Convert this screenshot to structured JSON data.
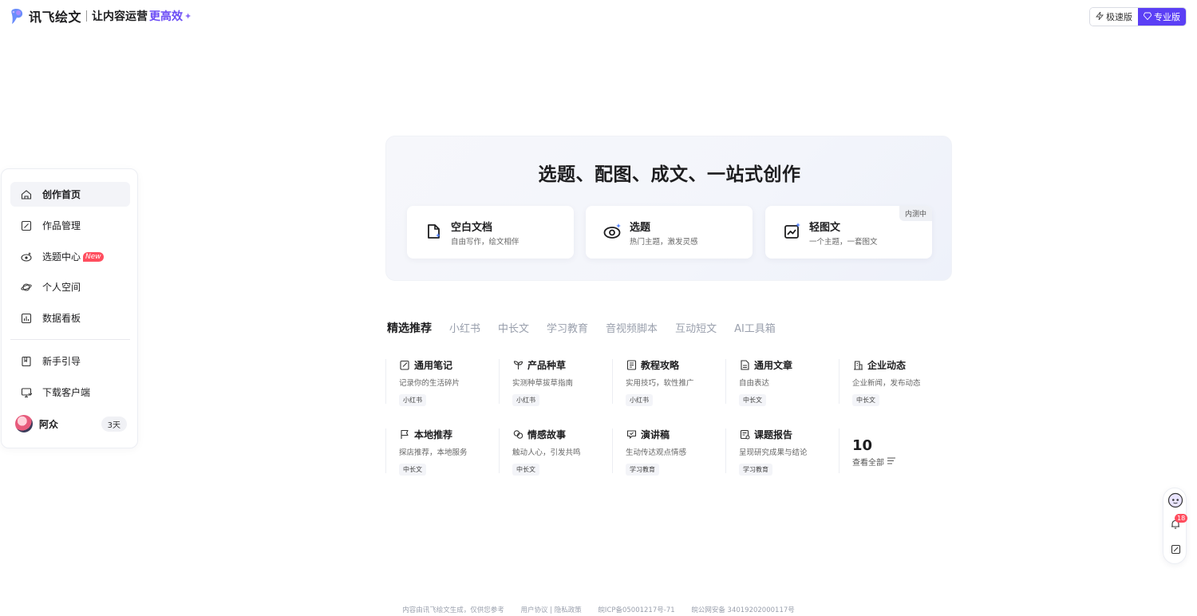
{
  "header": {
    "brand": "讯飞绘文",
    "slogan": "让内容运营",
    "slogan_accent": "更高效",
    "versions": [
      {
        "label": "极速版",
        "icon": "lightning-icon",
        "active": false
      },
      {
        "label": "专业版",
        "icon": "diamond-icon",
        "active": true
      }
    ]
  },
  "sidebar": {
    "items": [
      {
        "label": "创作首页",
        "icon": "home-icon",
        "active": true
      },
      {
        "label": "作品管理",
        "icon": "edit-doc-icon"
      },
      {
        "label": "选题中心",
        "icon": "eye-sparkle-icon",
        "badge": "New"
      },
      {
        "label": "个人空间",
        "icon": "planet-icon"
      },
      {
        "label": "数据看板",
        "icon": "chart-board-icon"
      },
      {
        "label": "新手引导",
        "icon": "book-icon"
      },
      {
        "label": "下载客户端",
        "icon": "monitor-download-icon"
      }
    ],
    "user": {
      "name": "阿众",
      "days": "3天"
    }
  },
  "hero": {
    "title": "选题、配图、成文、一站式创作",
    "cards": [
      {
        "title": "空白文档",
        "desc": "自由写作，绘文相伴",
        "icon": "doc-sparkle-icon"
      },
      {
        "title": "选题",
        "desc": "热门主题，激发灵感",
        "icon": "eye-sparkle-icon"
      },
      {
        "title": "轻图文",
        "desc": "一个主题，一套图文",
        "icon": "chart-sparkle-icon",
        "tag": "内测中"
      }
    ]
  },
  "tabs": [
    "精选推荐",
    "小红书",
    "中长文",
    "学习教育",
    "音视频脚本",
    "互动短文",
    "AI工具箱"
  ],
  "templates": [
    {
      "title": "通用笔记",
      "desc": "记录你的生活碎片",
      "tag": "小红书",
      "icon": "note-edit-icon"
    },
    {
      "title": "产品种草",
      "desc": "实测种草拔草指南",
      "tag": "小红书",
      "icon": "sprout-icon"
    },
    {
      "title": "教程攻略",
      "desc": "实用技巧，软性推广",
      "tag": "小红书",
      "icon": "book-list-icon"
    },
    {
      "title": "通用文章",
      "desc": "自由表达",
      "tag": "中长文",
      "icon": "article-icon"
    },
    {
      "title": "企业动态",
      "desc": "企业新闻，发布动态",
      "tag": "中长文",
      "icon": "building-icon"
    },
    {
      "title": "本地推荐",
      "desc": "探店推荐，本地服务",
      "tag": "中长文",
      "icon": "flag-icon"
    },
    {
      "title": "情感故事",
      "desc": "触动人心，引发共鸣",
      "tag": "中长文",
      "icon": "hearts-icon"
    },
    {
      "title": "演讲稿",
      "desc": "生动传达观点情感",
      "tag": "学习教育",
      "icon": "speech-icon"
    },
    {
      "title": "课题报告",
      "desc": "呈现研究成果与结论",
      "tag": "学习教育",
      "icon": "report-icon"
    }
  ],
  "more": {
    "count": "10",
    "label": "查看全部"
  },
  "float": {
    "notifications": "18"
  },
  "footer": {
    "disclaimer": "内容由讯飞绘文生成，仅供您参考",
    "links": "用户协议 | 隐私政策",
    "icp": "皖ICP备05001217号-71",
    "police": "皖公网安备 34019202000117号"
  },
  "colors": {
    "accent": "#5b3ff5",
    "badge": "#ff4d5e"
  }
}
